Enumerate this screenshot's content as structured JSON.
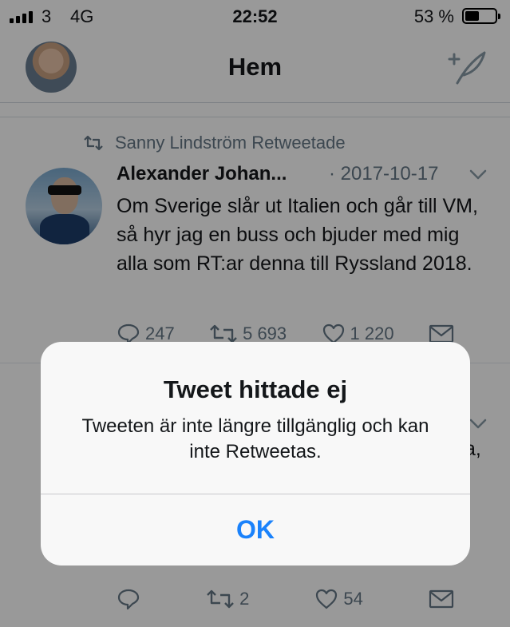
{
  "status": {
    "carrier": "3",
    "network": "4G",
    "time": "22:52",
    "battery_percent": "53 %",
    "battery_level": 0.53
  },
  "nav": {
    "title": "Hem",
    "compose_icon": "compose-tweet-icon",
    "avatar_icon": "profile-avatar"
  },
  "tweet": {
    "retweet_label": "Sanny Lindström Retweetade",
    "author": "Alexander Johan...",
    "date": "· 2017-10-17",
    "text": "Om Sverige slår ut Italien och går till VM, så hyr jag en buss och bjuder med mig alla som RT:ar denna till Ryssland 2018.",
    "replies": "247",
    "retweets": "5 693",
    "likes": "1 220"
  },
  "tweet2": {
    "text_fragment": "a,",
    "retweets": "2",
    "likes": "54"
  },
  "alert": {
    "title": "Tweet hittade ej",
    "message": "Tweeten är inte längre tillgänglig och kan inte Retweetas.",
    "ok_label": "OK"
  },
  "colors": {
    "accent": "#1a82fb",
    "secondary_text": "#657786",
    "like_red": "#e0245e"
  }
}
